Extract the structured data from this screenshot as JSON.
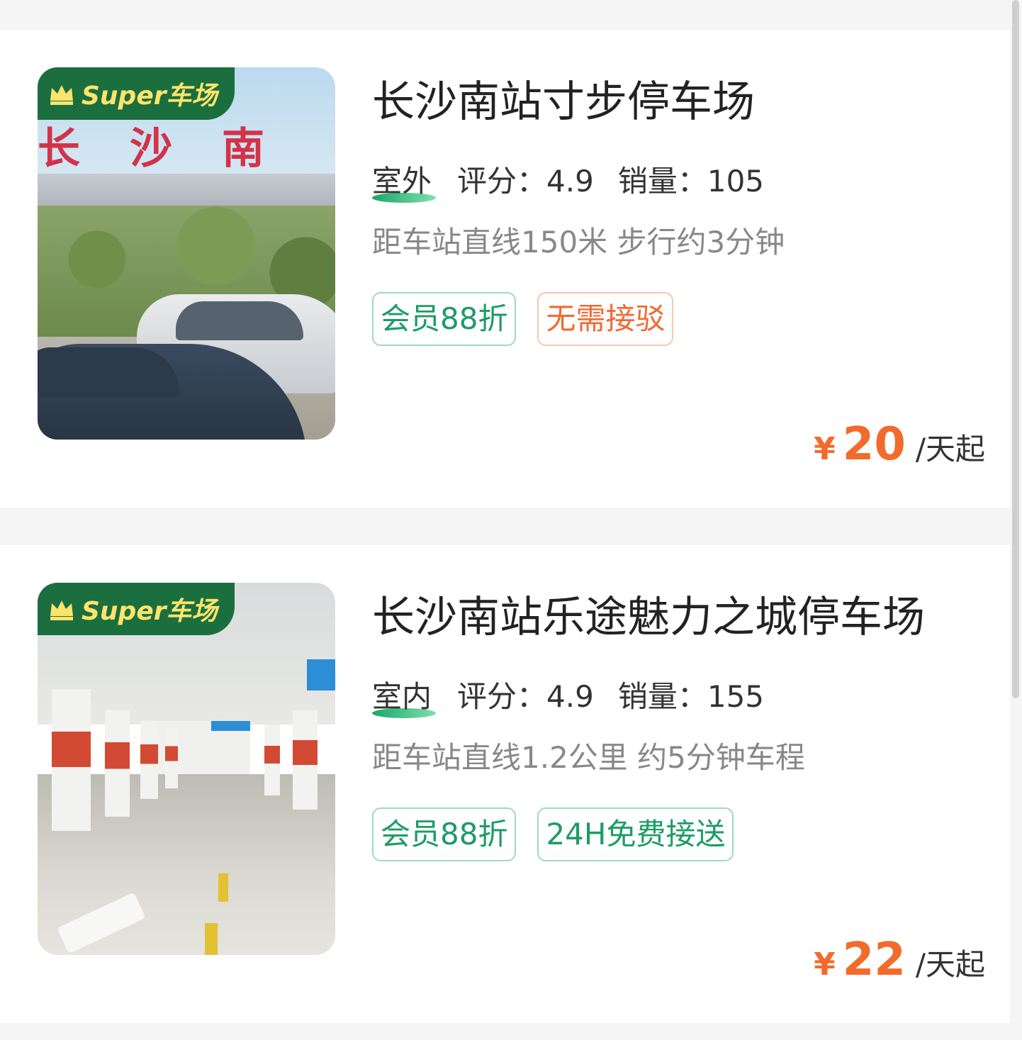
{
  "listings": [
    {
      "badge": "Super车场",
      "name": "长沙南站寸步停车场",
      "type": "室外",
      "rating_label": "评分：",
      "rating": "4.9",
      "sales_label": "销量：",
      "sales": "105",
      "distance": "距车站直线150米 步行约3分钟",
      "tags": [
        {
          "label": "会员88折",
          "color": "green"
        },
        {
          "label": "无需接驳",
          "color": "orange"
        }
      ],
      "currency": "¥",
      "price": "20",
      "unit": "/天起",
      "photo_sign": "长沙南"
    },
    {
      "badge": "Super车场",
      "name": "长沙南站乐途魅力之城停车场",
      "type": "室内",
      "rating_label": "评分：",
      "rating": "4.9",
      "sales_label": "销量：",
      "sales": "155",
      "distance": "距车站直线1.2公里 约5分钟车程",
      "tags": [
        {
          "label": "会员88折",
          "color": "green"
        },
        {
          "label": "24H免费接送",
          "color": "green"
        }
      ],
      "currency": "¥",
      "price": "22",
      "unit": "/天起"
    }
  ],
  "colors": {
    "accent_green": "#1d9b68",
    "accent_orange": "#f26b2c",
    "badge_bg": "#1b6e3e",
    "badge_text": "#ffe46b"
  },
  "icons": {
    "badge_icon": "crown-icon"
  }
}
